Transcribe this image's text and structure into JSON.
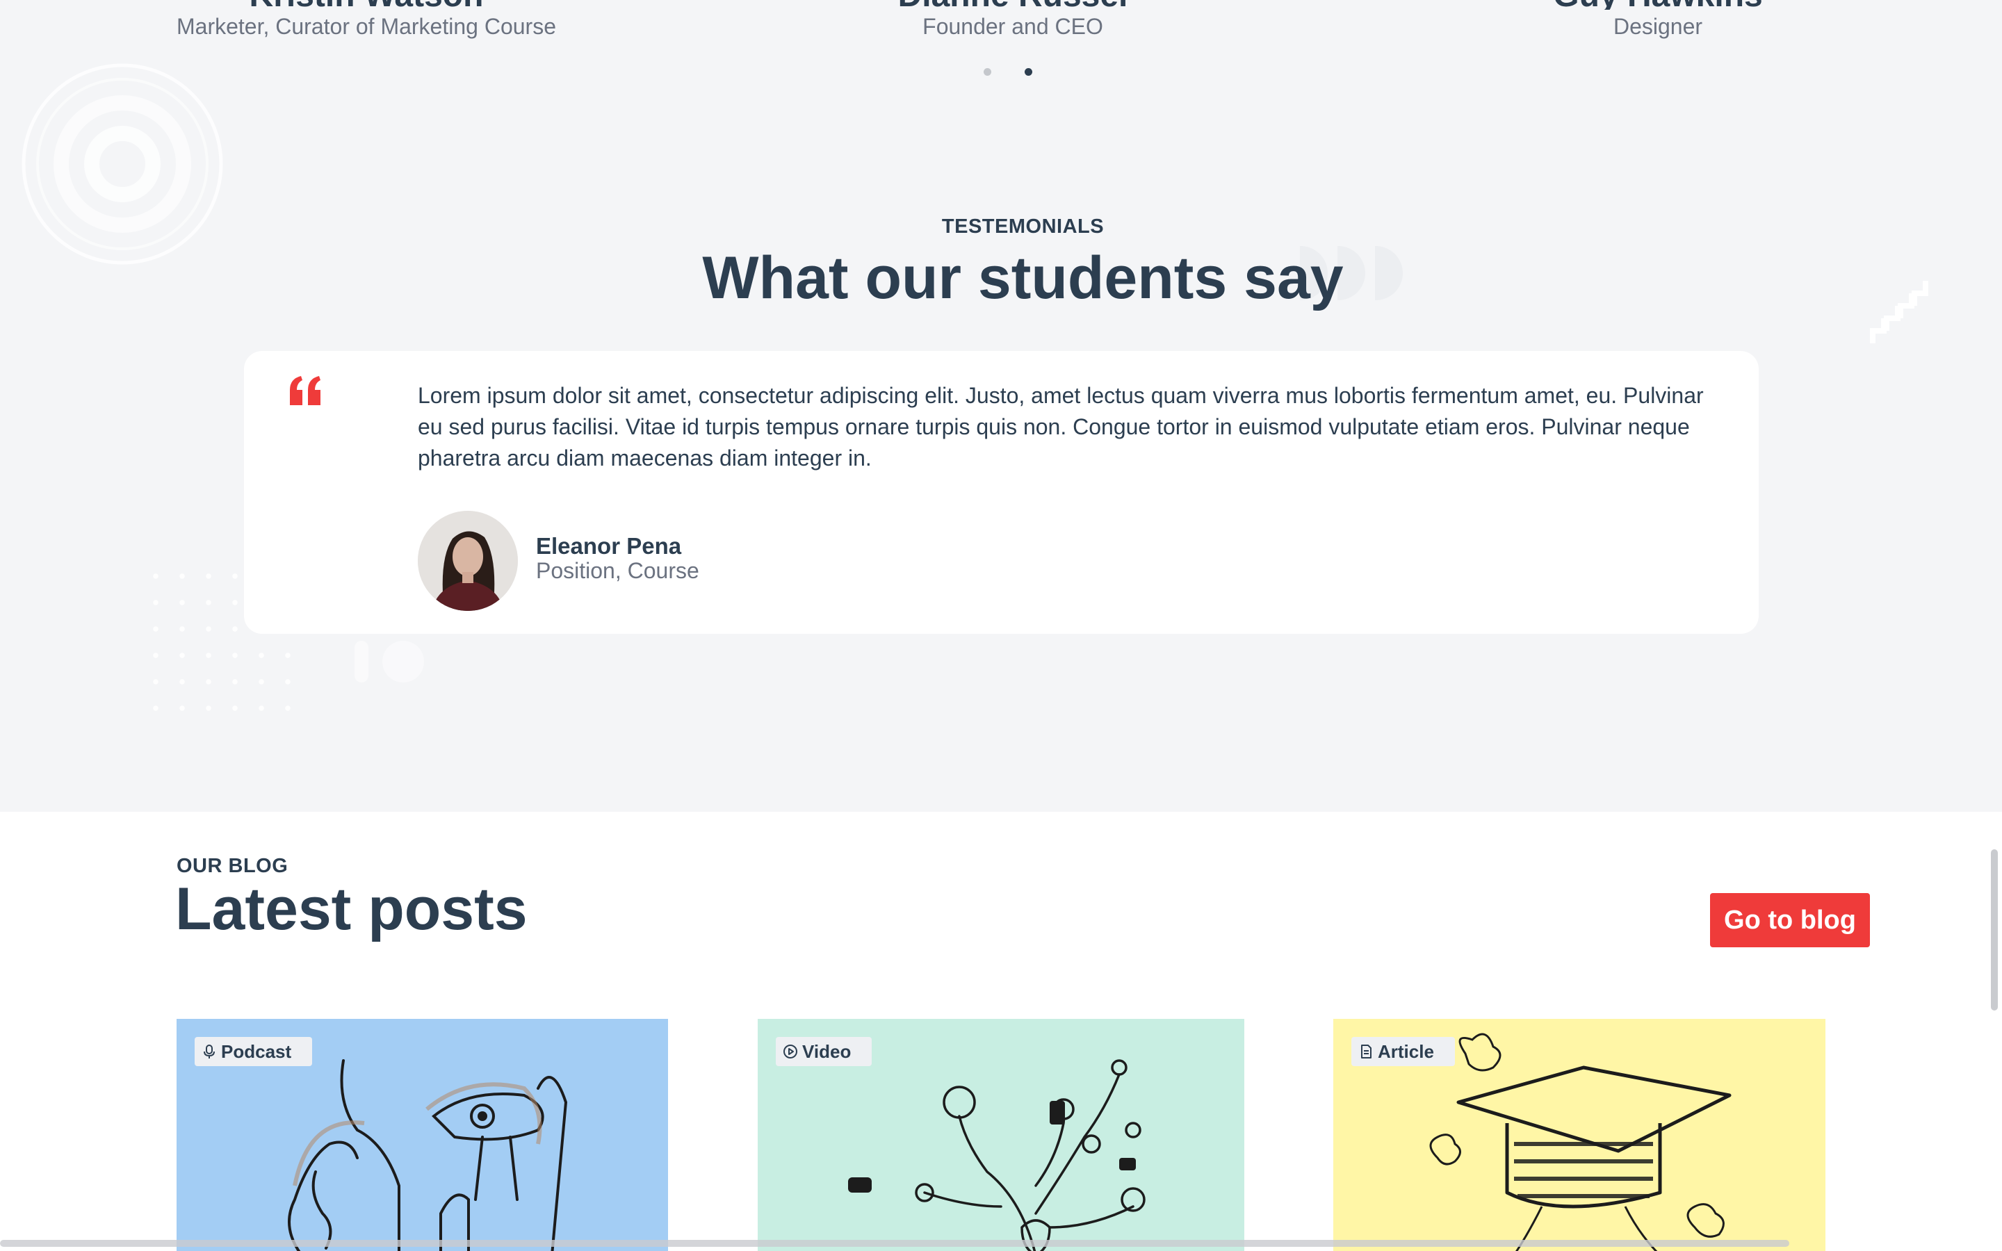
{
  "team": {
    "members": [
      {
        "name": "Kristin Watson",
        "role": "Marketer, Curator of Marketing Course"
      },
      {
        "name": "Dianne Russel",
        "role": "Founder and CEO"
      },
      {
        "name": "Guy Hawkins",
        "role": "Designer"
      }
    ],
    "carousel": {
      "pages": 2,
      "active_page": 2
    }
  },
  "testimonials": {
    "eyebrow": "TESTEMONIALS",
    "title": "What our students say",
    "quote": "Lorem ipsum dolor sit amet, consectetur adipiscing elit. Justo, amet lectus quam viverra mus lobortis fermentum amet, eu. Pulvinar eu sed purus facilisi. Vitae id turpis tempus ornare turpis quis non. Congue tortor in euismod vulputate etiam eros. Pulvinar neque pharetra arcu diam maecenas diam integer in.",
    "author_name": "Eleanor Pena",
    "author_position": "Position, Course"
  },
  "blog": {
    "eyebrow": "OUR BLOG",
    "title": "Latest posts",
    "button_label": "Go to blog",
    "posts": [
      {
        "tag": "Podcast",
        "icon": "microphone-icon",
        "color": "#a3cdf4"
      },
      {
        "tag": "Video",
        "icon": "play-circle-icon",
        "color": "#c8eee2"
      },
      {
        "tag": "Article",
        "icon": "document-icon",
        "color": "#fff6a6"
      }
    ]
  },
  "colors": {
    "accent": "#ef3b3a",
    "heading": "#2c3e50",
    "muted": "#6b7280",
    "section_bg": "#f4f5f7"
  }
}
